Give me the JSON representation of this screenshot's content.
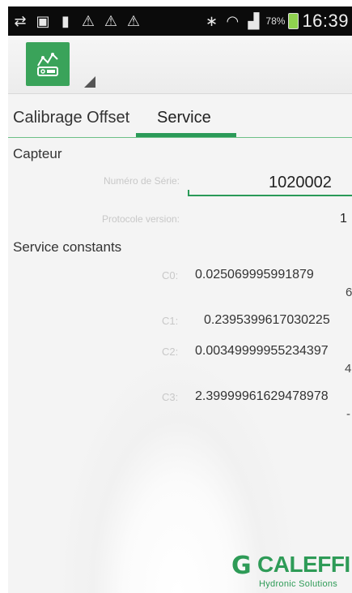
{
  "statusbar": {
    "icons": [
      "usb-icon",
      "screen-share-icon",
      "battery-app-icon",
      "warning-icon",
      "warning-icon",
      "warning-icon",
      "bluetooth-icon",
      "wifi-icon",
      "signal-icon"
    ],
    "battery_percent": "78%",
    "time": "16:39"
  },
  "tabs": [
    {
      "label": "Calibrage Offset",
      "selected": false
    },
    {
      "label": "Service",
      "selected": true
    }
  ],
  "capteur": {
    "title": "Capteur",
    "serial_label": "Numéro de Série:",
    "serial_value": "1020002",
    "protocol_label": "Protocole version:",
    "protocol_value": "1"
  },
  "constants": {
    "title": "Service constants",
    "items": [
      {
        "label": "C0:",
        "value": "0.025069995991879",
        "continuation": "6"
      },
      {
        "label": "C1:",
        "value": "0.2395399617030225",
        "continuation": ""
      },
      {
        "label": "C2:",
        "value": "0.00349999955234397",
        "continuation": "4"
      },
      {
        "label": "C3:",
        "value": "2.39999961629478978",
        "continuation": "-"
      }
    ]
  },
  "logo": {
    "name": "CALEFFI",
    "tagline": "Hydronic Solutions"
  },
  "colors": {
    "accent": "#2a9a58",
    "app_icon_bg": "#3aa35a",
    "status_bar": "#0b0b0b"
  }
}
